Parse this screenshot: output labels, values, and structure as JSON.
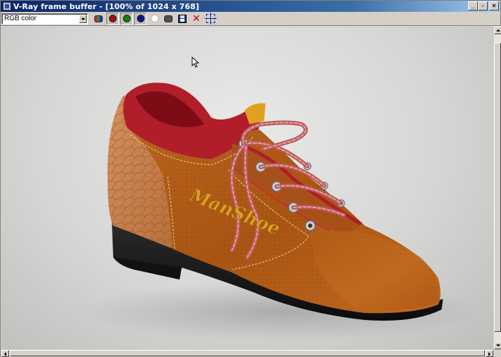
{
  "window": {
    "title": "V-Ray frame buffer - [100% of 1024 x 768]",
    "buttons": {
      "minimize": "_",
      "restore": "▫",
      "close": "×"
    }
  },
  "toolbar": {
    "channel": {
      "selected": "RGB color"
    },
    "tools": [
      {
        "name": "show-rgb-channels",
        "icon": "rgb-channels-icon"
      },
      {
        "name": "red-channel",
        "icon": "red-circle-icon",
        "color": "#a01010"
      },
      {
        "name": "green-channel",
        "icon": "green-circle-icon",
        "color": "#108010"
      },
      {
        "name": "blue-channel",
        "icon": "blue-circle-icon",
        "color": "#101090"
      },
      {
        "name": "alpha-channel",
        "icon": "white-circle-icon",
        "color": "#ffffff"
      },
      {
        "name": "monochrome",
        "icon": "mono-icon"
      },
      {
        "name": "save-image",
        "icon": "floppy-disk-icon"
      },
      {
        "name": "clear-image",
        "icon": "red-x-icon",
        "color": "#c00000"
      },
      {
        "name": "region-render",
        "icon": "region-crosshair-icon"
      }
    ]
  },
  "render": {
    "logo_text": "ManShoe",
    "colors": {
      "background": "#d6d6d4",
      "suede": "#b05a16",
      "leather_panel": "#c8804a",
      "collar": "#b01e2a",
      "sole": "#1a1a1a",
      "logo": "#e0a020",
      "lace": "#d07878"
    }
  }
}
